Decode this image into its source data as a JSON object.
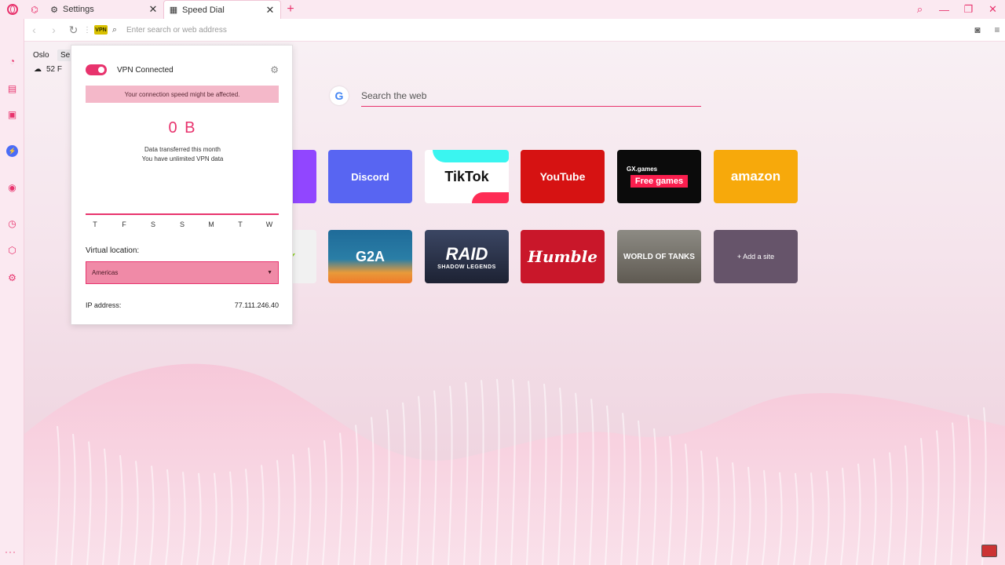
{
  "tabs": {
    "settings": "Settings",
    "speed_dial": "Speed Dial"
  },
  "addressbar": {
    "vpn_badge": "VPN",
    "placeholder": "Enter search or web address"
  },
  "weather": {
    "city": "Oslo",
    "settings_button": "Se",
    "temperature": "52 F"
  },
  "search": {
    "engine_logo": "G",
    "placeholder": "Search the web"
  },
  "tiles": {
    "discord": "Discord",
    "tiktok": "TikTok",
    "youtube": "YouTube",
    "gx_games_top": "GX.games",
    "gx_games_badge": "Free games",
    "amazon": "amazon",
    "g2a": "G2A",
    "raid": "RAID",
    "raid_sub": "SHADOW LEGENDS",
    "humble": "Humble",
    "wot": "WORLD OF TANKS",
    "add_site": "+ Add a site"
  },
  "vpn": {
    "status": "VPN Connected",
    "warning": "Your connection speed might be affected.",
    "data_amount": "0 B",
    "data_caption_1": "Data transferred this month",
    "data_caption_2": "You have unlimited VPN data",
    "days": [
      "T",
      "F",
      "S",
      "S",
      "M",
      "T",
      "W"
    ],
    "location_label": "Virtual location:",
    "location_value": "Americas",
    "ip_label": "IP address:",
    "ip_value": "77.111.246.40",
    "accent_color": "#e8336d"
  },
  "icons": {
    "sidebar": [
      "speed-dial-icon",
      "extensions-icon",
      "twitch-icon",
      "messenger-icon",
      "player-icon",
      "history-icon",
      "cube-icon",
      "settings-icon"
    ]
  }
}
